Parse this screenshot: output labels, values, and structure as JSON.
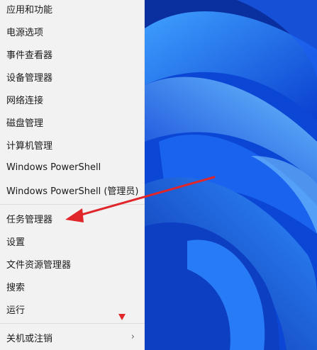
{
  "menu": {
    "items": [
      {
        "label": "应用和功能"
      },
      {
        "label": "电源选项"
      },
      {
        "label": "事件查看器"
      },
      {
        "label": "设备管理器"
      },
      {
        "label": "网络连接"
      },
      {
        "label": "磁盘管理"
      },
      {
        "label": "计算机管理"
      },
      {
        "label": "Windows PowerShell"
      },
      {
        "label": "Windows PowerShell (管理员)"
      },
      {
        "label": "任务管理器"
      },
      {
        "label": "设置"
      },
      {
        "label": "文件资源管理器"
      },
      {
        "label": "搜索"
      },
      {
        "label": "运行"
      },
      {
        "label": "关机或注销",
        "submenu": true
      }
    ]
  },
  "colors": {
    "menu_background": "#f2f2f2",
    "wallpaper_blue": "#0a4fd6",
    "annotation_red": "#e0262a"
  },
  "icons": {
    "submenu": "chevron-right-icon",
    "annotation_marker": "triangle-down-icon"
  }
}
